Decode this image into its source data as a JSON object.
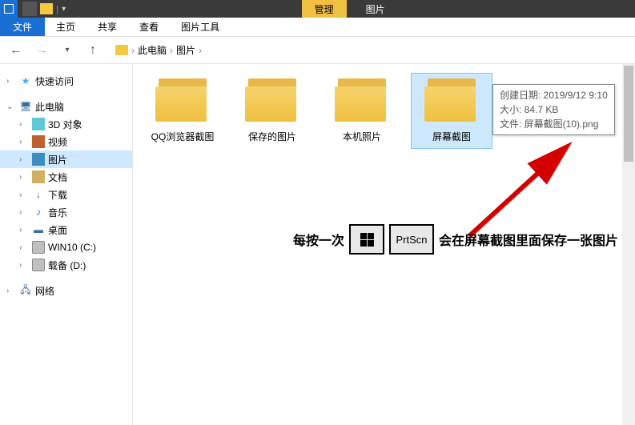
{
  "titlebar": {
    "ribbon_tab": "管理",
    "context_title": "图片"
  },
  "menubar": {
    "file": "文件",
    "home": "主页",
    "share": "共享",
    "view": "查看",
    "picture_tools": "图片工具"
  },
  "breadcrumb": {
    "pc": "此电脑",
    "pictures": "图片"
  },
  "sidebar": {
    "quick_access": "快速访问",
    "this_pc": "此电脑",
    "objects_3d": "3D 对象",
    "videos": "视频",
    "pictures": "图片",
    "documents": "文档",
    "downloads": "下载",
    "music": "音乐",
    "desktop": "桌面",
    "drive_c": "WIN10 (C:)",
    "drive_d": "载备 (D:)",
    "network": "网络"
  },
  "folders": {
    "f1": "QQ浏览器截图",
    "f2": "保存的图片",
    "f3": "本机照片",
    "f4": "屏幕截图"
  },
  "tooltip": {
    "line1": "创建日期: 2019/9/12 9:10",
    "line2": "大小: 84.7 KB",
    "line3": "文件: 屏幕截图(10).png"
  },
  "instruction": {
    "before": "每按一次",
    "key2": "PrtScn",
    "after": "会在屏幕截图里面保存一张图片"
  }
}
